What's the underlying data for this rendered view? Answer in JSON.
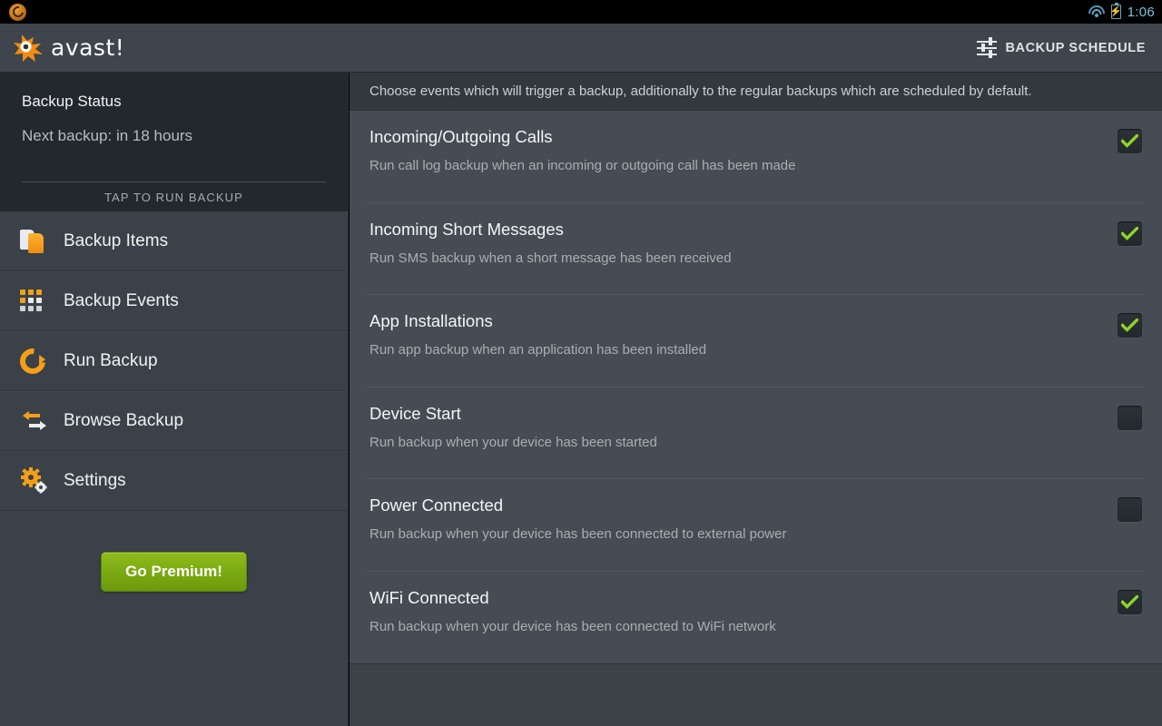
{
  "statusbar": {
    "app_icon": "avast-notification-icon",
    "wifi_icon": "wifi-icon",
    "battery_icon": "battery-charging-icon",
    "clock": "1:06",
    "accent_color": "#5fa8c4"
  },
  "actionbar": {
    "logo_text": "avast!",
    "logo_icon": "avast-logo-icon",
    "action_icon": "sliders-icon",
    "action_label": "BACKUP SCHEDULE",
    "background_color": "#3e454c"
  },
  "sidebar": {
    "status": {
      "title": "Backup Status",
      "subtitle": "Next backup: in 18 hours",
      "tap_label": "TAP TO RUN BACKUP"
    },
    "items": [
      {
        "label": "Backup Items",
        "icon": "documents-icon"
      },
      {
        "label": "Backup Events",
        "icon": "grid-icon"
      },
      {
        "label": "Run Backup",
        "icon": "refresh-circle-icon"
      },
      {
        "label": "Browse Backup",
        "icon": "arrows-icon"
      },
      {
        "label": "Settings",
        "icon": "gears-icon"
      }
    ],
    "premium_button": "Go Premium!",
    "premium_color": "#7bab12"
  },
  "content": {
    "hint": "Choose events which will trigger a backup, additionally to the regular backups which are scheduled by default.",
    "check_color": "#8fd428",
    "events": [
      {
        "title": "Incoming/Outgoing Calls",
        "description": "Run call log backup when an incoming or outgoing call has been made",
        "checked": true
      },
      {
        "title": "Incoming Short Messages",
        "description": "Run SMS backup when a short message has been received",
        "checked": true
      },
      {
        "title": "App Installations",
        "description": "Run app backup when an application has been installed",
        "checked": true
      },
      {
        "title": "Device Start",
        "description": "Run backup when your device has been started",
        "checked": false
      },
      {
        "title": "Power Connected",
        "description": "Run backup when your device has been connected to external power",
        "checked": false
      },
      {
        "title": "WiFi Connected",
        "description": "Run backup when your device has been connected to WiFi network",
        "checked": true
      }
    ]
  }
}
